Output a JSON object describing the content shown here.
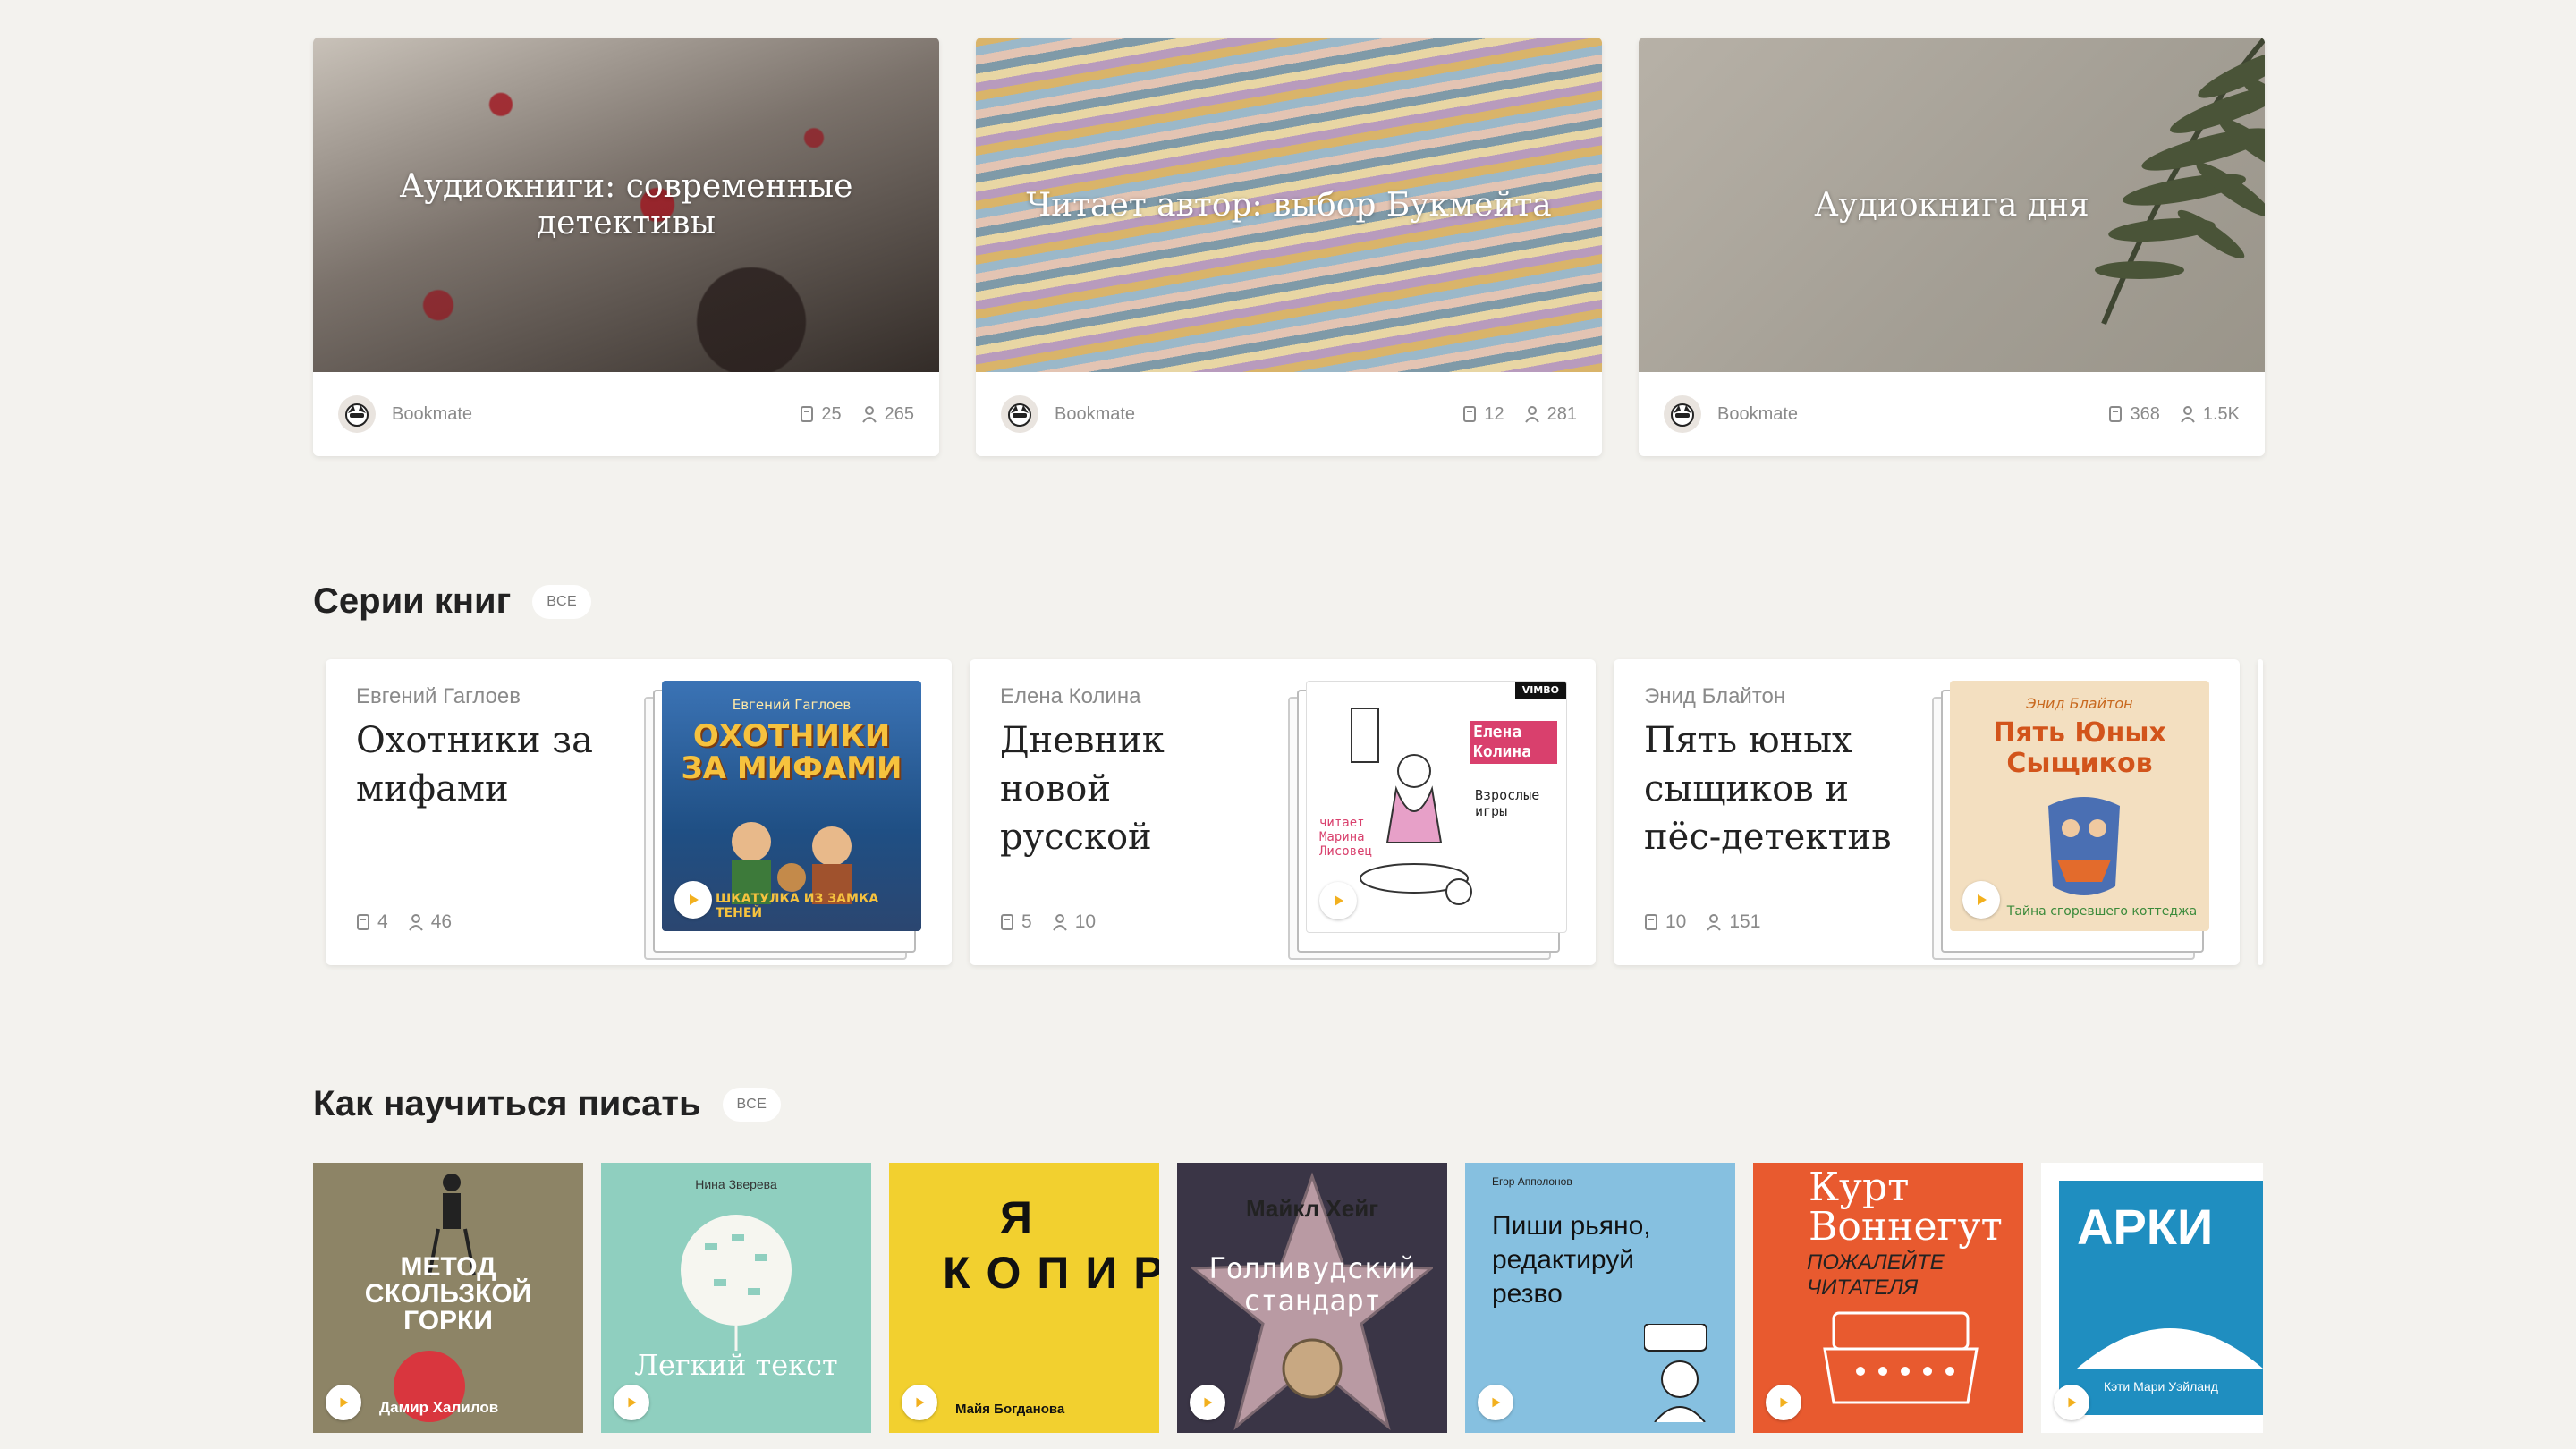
{
  "shelves": [
    {
      "title": "Аудиокниги: современные детективы",
      "author": "Bookmate",
      "books": "25",
      "followers": "265"
    },
    {
      "title": "Читает автор: выбор Букмейта",
      "author": "Bookmate",
      "books": "12",
      "followers": "281"
    },
    {
      "title": "Аудиокнига дня",
      "author": "Bookmate",
      "books": "368",
      "followers": "1.5K"
    }
  ],
  "series_section": {
    "title": "Серии книг",
    "all_label": "ВСЕ"
  },
  "series": [
    {
      "author": "Евгений Гаглоев",
      "title": "Охотники за мифами",
      "books": "4",
      "followers": "46",
      "cover_top": "Евгений Гаглоев",
      "cover_title": "ОХОТНИКИ ЗА МИФАМИ",
      "cover_bottom": "ШКАТУЛКА ИЗ ЗАМКА ТЕНЕЙ"
    },
    {
      "author": "Елена Колина",
      "title": "Дневник новой русской",
      "books": "5",
      "followers": "10",
      "cover_badge": "VIMBO",
      "cover_top": "Елена Колина",
      "cover_title": "Взрослые игры",
      "cover_bottom": "читает Марина Лисовец"
    },
    {
      "author": "Энид Блайтон",
      "title": "Пять юных сыщиков и пёс-детектив",
      "books": "10",
      "followers": "151",
      "cover_top": "Энид Блайтон",
      "cover_title": "Пять Юных Сыщиков",
      "cover_bottom": "Тайна сгоревшего коттеджа"
    }
  ],
  "writing_section": {
    "title": "Как научиться писать",
    "all_label": "ВСЕ"
  },
  "books": [
    {
      "title": "МЕТОД СКОЛЬЗКОЙ ГОРКИ",
      "author": "Дамир Халилов"
    },
    {
      "title": "Легкий текст",
      "author": "Нина Зверева"
    },
    {
      "title": "Я КОПИРАЙТЕР",
      "author": "Майя Богданова"
    },
    {
      "title": "Голливудский стандарт",
      "author": "Майкл Хейг"
    },
    {
      "title": "Пиши рьяно, редактируй резво",
      "author": "Егор Апполонов"
    },
    {
      "title": "ПОЖАЛЕЙТЕ ЧИТАТЕЛЯ",
      "author": "Курт Воннегут"
    },
    {
      "title": "АРКИ",
      "author": "Кэти Мари Уэйланд"
    }
  ],
  "colors": {
    "background": "#f3f2ee",
    "card": "#ffffff",
    "play_accent": "#f2b01e"
  }
}
